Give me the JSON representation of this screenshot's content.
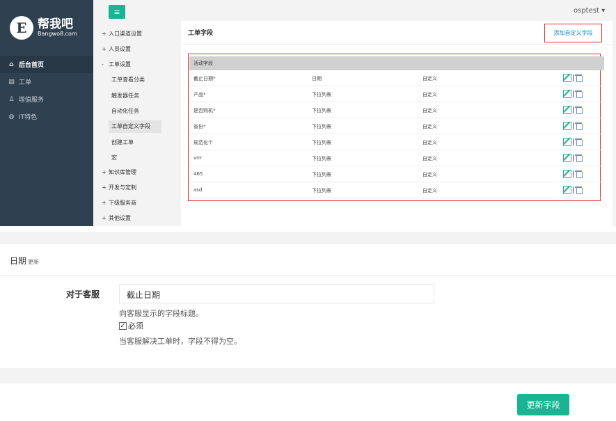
{
  "brand": {
    "logo_char": "E",
    "name": "帮我吧",
    "domain": "Bangwo8.com"
  },
  "user": {
    "name": "osptest",
    "caret": "▾"
  },
  "menu_toggle_glyph": "≡",
  "sidebar": {
    "items": [
      {
        "label": "后台首页",
        "icon": "home-icon",
        "glyph": "⌂",
        "active": true
      },
      {
        "label": "工单",
        "icon": "ticket-icon",
        "glyph": "▤",
        "active": false
      },
      {
        "label": "增值服务",
        "icon": "service-icon",
        "glyph": "♙",
        "active": false
      },
      {
        "label": "IT特色",
        "icon": "globe-icon",
        "glyph": "◍",
        "active": false
      }
    ]
  },
  "subnav": {
    "groups": [
      {
        "marker": "+",
        "label": "入口渠道设置"
      },
      {
        "marker": "+",
        "label": "人员设置"
      },
      {
        "marker": "-",
        "label": "工单设置"
      },
      {
        "marker": "+",
        "label": "知识库管理"
      },
      {
        "marker": "+",
        "label": "开发与定制"
      },
      {
        "marker": "+",
        "label": "下级服务商"
      },
      {
        "marker": "+",
        "label": "其他设置"
      }
    ],
    "children": [
      {
        "label": "工单查看分类"
      },
      {
        "label": "触发器任务"
      },
      {
        "label": "自动化任务"
      },
      {
        "label": "工单自定义字段",
        "selected": true
      },
      {
        "label": "创建工单"
      },
      {
        "label": "宏"
      }
    ]
  },
  "content": {
    "title": "工单字段",
    "add_link": "添加自定义字段",
    "table_header": "活动字段",
    "rows": [
      {
        "name": "截止日期*",
        "type": "日期",
        "source": "自定义"
      },
      {
        "name": "产品*",
        "type": "下拉列表",
        "source": "自定义"
      },
      {
        "name": "是否购机*",
        "type": "下拉列表",
        "source": "自定义"
      },
      {
        "name": "省份*",
        "type": "下拉列表",
        "source": "自定义"
      },
      {
        "name": "规范化个",
        "type": "下拉列表",
        "source": "自定义"
      },
      {
        "name": "vrrr",
        "type": "下拉列表",
        "source": "自定义"
      },
      {
        "name": "465",
        "type": "下拉列表",
        "source": "自定义"
      },
      {
        "name": "asd",
        "type": "下拉列表",
        "source": "自定义"
      }
    ]
  },
  "form": {
    "section_title": "日期",
    "section_sub": "更新",
    "label_agent": "对于客服",
    "title_value": "截止日期",
    "help_title": "向客服显示的字段标题。",
    "required_label": "必须",
    "required_checked": true,
    "help_required": "当客服解决工单时，字段不得为空。",
    "submit": "更新字段"
  },
  "colors": {
    "accent": "#1ab394",
    "sidebar": "#2f4050",
    "highlight_box": "#d9342b",
    "link": "#1c84c6"
  }
}
